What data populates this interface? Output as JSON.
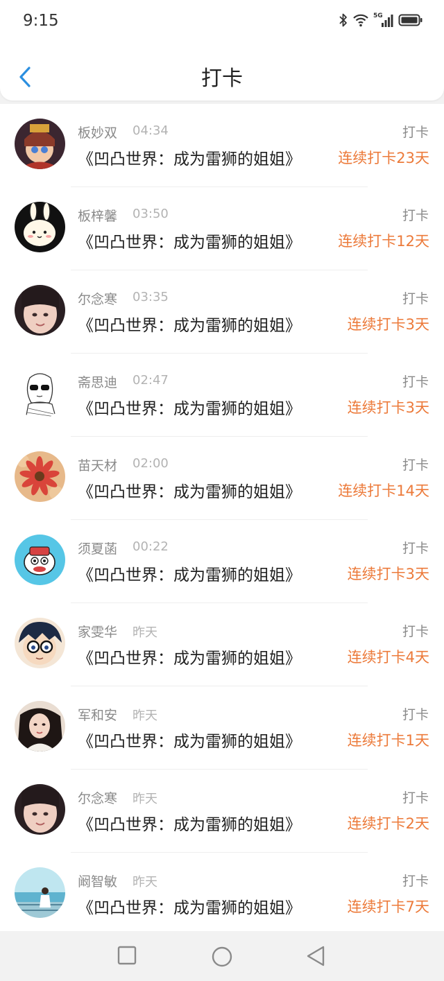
{
  "status_bar": {
    "time": "9:15",
    "network": "5G"
  },
  "header": {
    "title": "打卡"
  },
  "list": [
    {
      "name": "板妙双",
      "time": "04:34",
      "book": "《凹凸世界：成为雷狮的姐姐》",
      "action": "打卡",
      "streak": "连续打卡23天"
    },
    {
      "name": "板梓馨",
      "time": "03:50",
      "book": "《凹凸世界：成为雷狮的姐姐》",
      "action": "打卡",
      "streak": "连续打卡12天"
    },
    {
      "name": "尔念寒",
      "time": "03:35",
      "book": "《凹凸世界：成为雷狮的姐姐》",
      "action": "打卡",
      "streak": "连续打卡3天"
    },
    {
      "name": "斋思迪",
      "time": "02:47",
      "book": "《凹凸世界：成为雷狮的姐姐》",
      "action": "打卡",
      "streak": "连续打卡3天"
    },
    {
      "name": "苗天材",
      "time": "02:00",
      "book": "《凹凸世界：成为雷狮的姐姐》",
      "action": "打卡",
      "streak": "连续打卡14天"
    },
    {
      "name": "须夏菡",
      "time": "00:22",
      "book": "《凹凸世界：成为雷狮的姐姐》",
      "action": "打卡",
      "streak": "连续打卡3天"
    },
    {
      "name": "家雯华",
      "time": "昨天",
      "book": "《凹凸世界：成为雷狮的姐姐》",
      "action": "打卡",
      "streak": "连续打卡4天"
    },
    {
      "name": "军和安",
      "time": "昨天",
      "book": "《凹凸世界：成为雷狮的姐姐》",
      "action": "打卡",
      "streak": "连续打卡1天"
    },
    {
      "name": "尔念寒",
      "time": "昨天",
      "book": "《凹凸世界：成为雷狮的姐姐》",
      "action": "打卡",
      "streak": "连续打卡2天"
    },
    {
      "name": "阚智敏",
      "time": "昨天",
      "book": "《凹凸世界：成为雷狮的姐姐》",
      "action": "打卡",
      "streak": "连续打卡7天"
    }
  ],
  "colors": {
    "streak": "#ec7a3a",
    "accent": "#2b8fe0",
    "muted": "#8a8a8a"
  }
}
